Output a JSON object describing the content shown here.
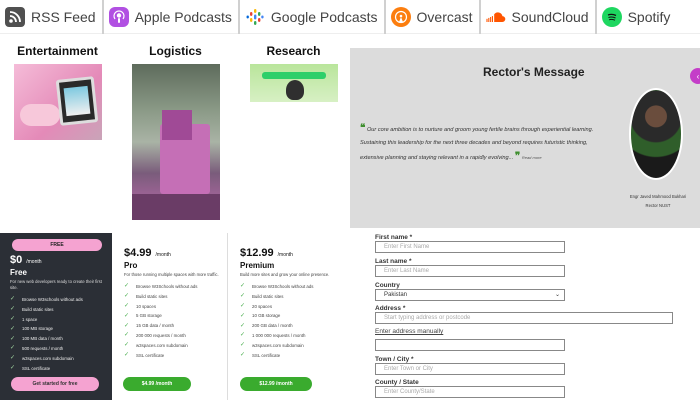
{
  "podcasts": [
    {
      "label": "RSS Feed",
      "icon": "rss-icon"
    },
    {
      "label": "Apple Podcasts",
      "icon": "apple-podcasts-icon"
    },
    {
      "label": "Google Podcasts",
      "icon": "google-podcasts-icon"
    },
    {
      "label": "Overcast",
      "icon": "overcast-icon"
    },
    {
      "label": "SoundCloud",
      "icon": "soundcloud-icon"
    },
    {
      "label": "Spotify",
      "icon": "spotify-icon"
    }
  ],
  "services": {
    "entertainment": "Entertainment",
    "logistics": "Logistics",
    "research": "Research"
  },
  "rector": {
    "title": "Rector's Message",
    "quote_line1": "Our core ambition is to nurture and groom young fertile brains through experiential learning.",
    "quote_line2": "Sustaining this leadership for the next three decades and beyond requires futuristic thinking,",
    "quote_line3": "extensive planning and staying relevant in a rapidly evolving...",
    "read_more": "Read more",
    "name": "Engr Javed Mahmood Bukhari",
    "role": "Rector NUST"
  },
  "pricing": {
    "free": {
      "badge": "FREE",
      "price": "$0",
      "period": "/month",
      "name": "Free",
      "desc": "For new web developers ready to create their first site.",
      "features": [
        "Browse W3schools without ads",
        "Build static sites",
        "1 space",
        "100 MB storage",
        "100 MB data / month",
        "500 requests / month",
        "w3spaces.com subdomain",
        "SSL certificate"
      ],
      "cta": "Get started for free"
    },
    "pro": {
      "price": "$4.99",
      "period": "/month",
      "name": "Pro",
      "desc": "For those running multiple spaces with more traffic.",
      "features": [
        "Browse W3Schools without ads",
        "Build static sites",
        "10 spaces",
        "5 GB storage",
        "15 GB data / month",
        "200 000 requests / month",
        "w3spaces.com subdomain",
        "SSL certificate"
      ],
      "cta": "$4.99 /month"
    },
    "premium": {
      "price": "$12.99",
      "period": "/month",
      "name": "Premium",
      "desc": "Build more sites and grow your online presence.",
      "features": [
        "Browse W3Schools without ads",
        "Build static sites",
        "20 spaces",
        "10 GB storage",
        "200 GB data / month",
        "1 000 000 requests / month",
        "w3spaces.com subdomain",
        "SSL certificate"
      ],
      "cta": "$12.99 /month"
    }
  },
  "form": {
    "first_name_label": "First name *",
    "first_name_placeholder": "Enter First Name",
    "last_name_label": "Last name *",
    "last_name_placeholder": "Enter Last Name",
    "country_label": "Country",
    "country_value": "Pakistan",
    "address_label": "Address *",
    "address_placeholder": "Start typing address or postcode",
    "manual_link": "Enter address manually",
    "town_label": "Town / City *",
    "town_placeholder": "Enter Town or City",
    "county_label": "County / State",
    "county_placeholder": "Enter County/State"
  },
  "colors": {
    "accent_pink": "#f5a3d1",
    "accent_green": "#3aab2e",
    "dark_panel": "#2b2f36",
    "rector_bg": "#dcdcdc",
    "magenta_button": "#c43ec8"
  }
}
